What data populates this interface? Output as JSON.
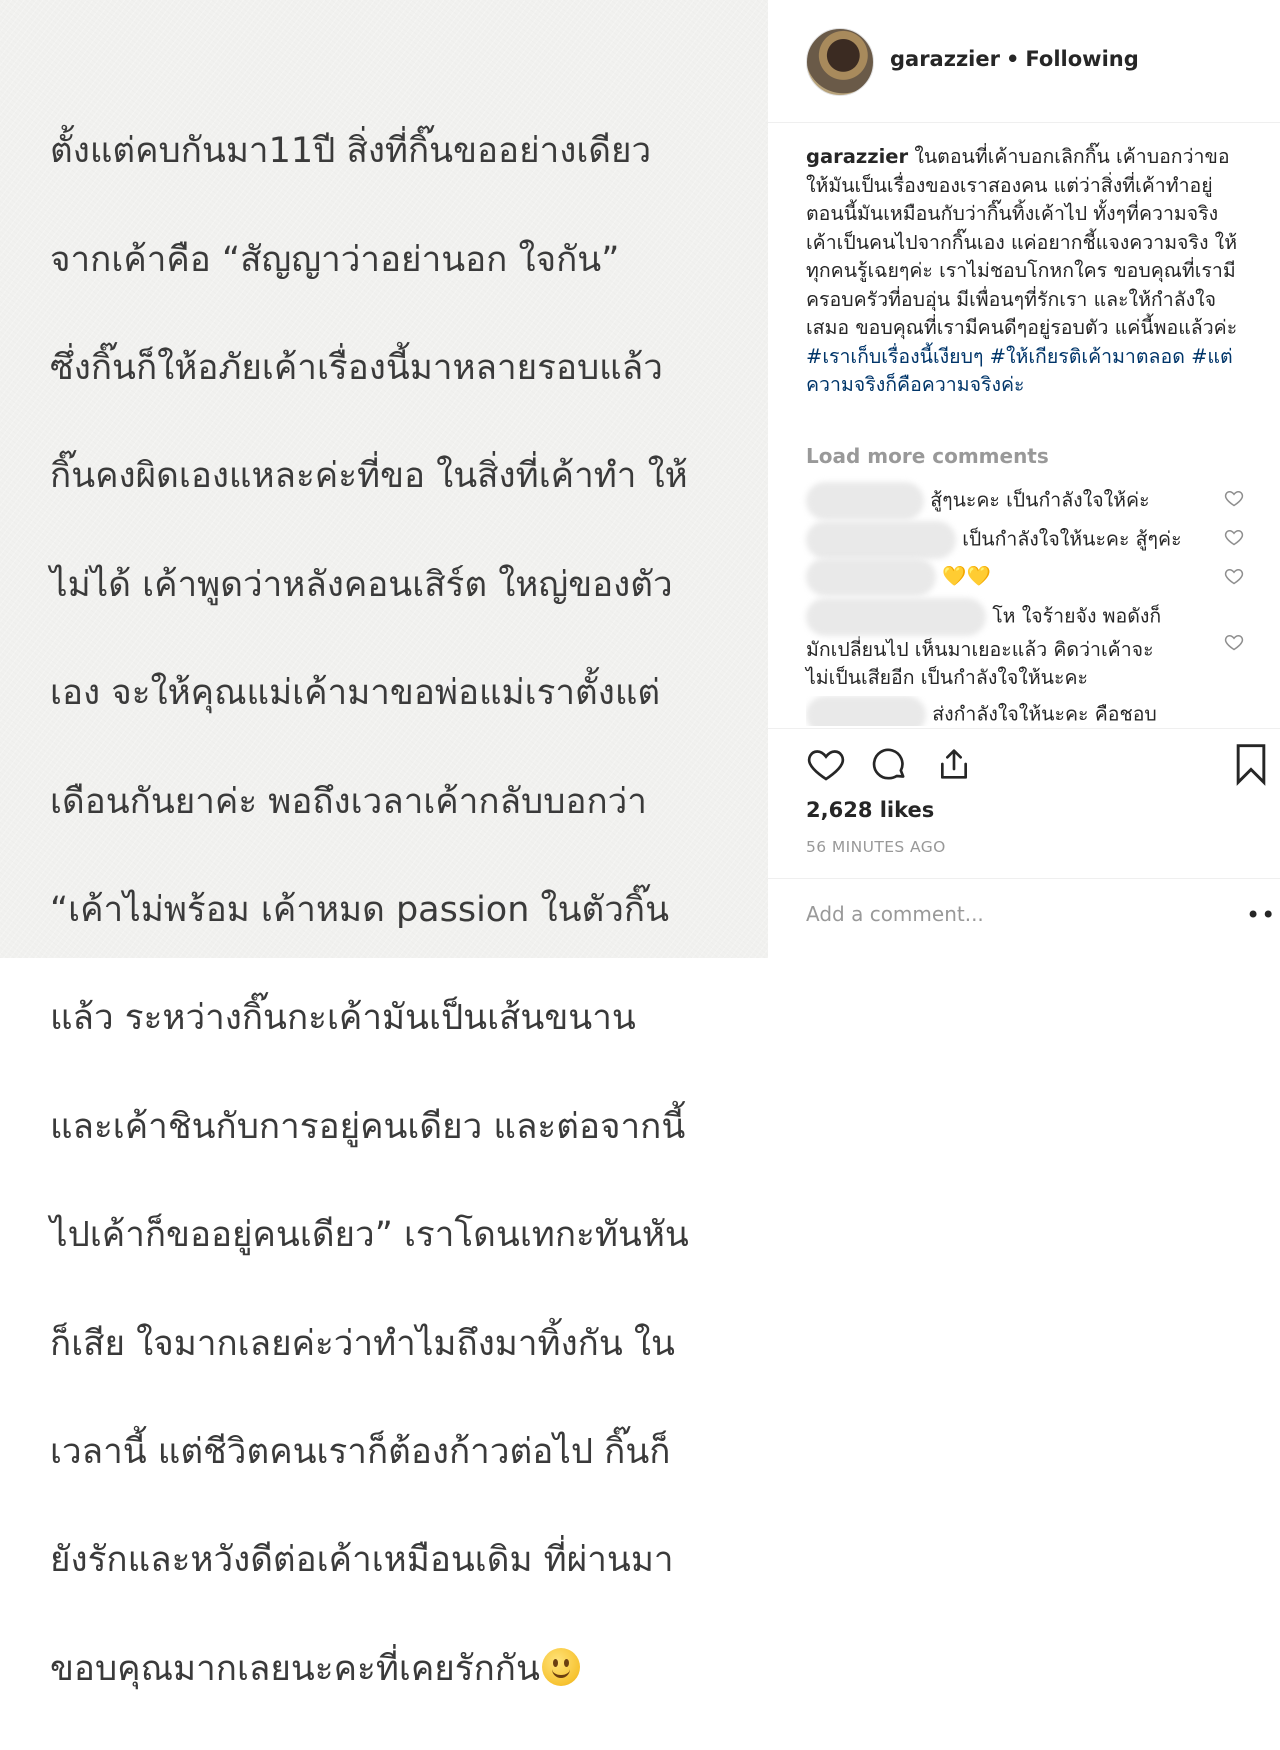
{
  "photo": {
    "lines": [
      "ตั้งแต่คบกันมา11ปี สิ่งที่กิ๊นขออย่างเดียว",
      "จากเค้าคือ “สัญญาว่าอย่านอก ใจกัน”",
      "ซึ่งกิ๊นก็ให้อภัยเค้าเรื่องนี้มาหลายรอบแล้ว",
      "กิ๊นคงผิดเองแหละค่ะที่ขอ ในสิ่งที่เค้าทำ ให้",
      "ไม่ได้ เค้าพูดว่าหลังคอนเสิร์ต ใหญ่ของตัว",
      "เอง จะให้คุณแม่เค้ามาขอพ่อแม่เราตั้งแต่",
      "เดือนกันยาค่ะ พอถึงเวลาเค้ากลับบอกว่า",
      "“เค้าไม่พร้อม เค้าหมด passion ในตัวกิ๊น",
      "แล้ว ระหว่างกิ๊นกะเค้ามันเป็นเส้นขนาน",
      "และเค้าชินกับการอยู่คนเดียว และต่อจากนี้",
      "ไปเค้าก็ขออยู่คนเดียว” เราโดนเทกะทันหัน",
      "ก็เสีย ใจมากเลยค่ะว่าทำไมถึงมาทิ้งกัน ใน",
      "เวลานี้ แต่ชีวิตคนเราก็ต้องก้าวต่อไป กิ๊นก็",
      "ยังรักและหวังดีต่อเค้าเหมือนเดิม ที่ผ่านมา",
      "ขอบคุณมากเลยนะคะที่เคยรักกัน"
    ]
  },
  "header": {
    "username": "garazzier",
    "separator": "•",
    "follow_status": "Following"
  },
  "caption": {
    "username": "garazzier",
    "text": "ในตอนที่เค้าบอกเลิกกิ๊น เค้าบอกว่าขอให้มันเป็นเรื่องของเราสองคน แต่ว่าสิ่งที่เค้าทำอยู่ตอนนี้มันเหมือนกับว่ากิ๊นทิ้งเค้าไป ทั้งๆที่ความจริงเค้าเป็นคนไปจากกิ๊นเอง แค่อยากชี้แจงความจริง ให้ทุกคนรู้เฉยๆค่ะ เราไม่ชอบโกหกใคร ขอบคุณที่เรามีครอบครัวที่อบอุ่น มีเพื่อนๆที่รักเรา และให้กำลังใจเสมอ ขอบคุณที่เรามีคนดีๆอยู่รอบตัว แค่นี้พอแล้วค่ะ",
    "tags": [
      "#เราเก็บเรื่องนี้เงียบๆ",
      "#ให้เกียรติเค้ามาตลอด",
      "#แต่ความจริงก็คือความจริงค่ะ"
    ]
  },
  "load_more": "Load more comments",
  "comments": [
    {
      "text": "สู้ๆนะคะ เป็นกำลังใจให้ค่ะ"
    },
    {
      "text": "เป็นกำลังใจให้นะคะ สู้ๆค่ะ"
    },
    {
      "text": "💛💛"
    },
    {
      "text_line1": "โห ใจร้ายจัง พอดังก็",
      "text_line2": "มักเปลี่ยนไป เห็นมาเยอะแล้ว คิดว่าเค้าจะ",
      "text_line3": "ไม่เป็นเสียอีก เป็นกำลังใจให้นะคะ"
    },
    {
      "text": "ส่งกำลังใจให้นะคะ คือชอบ"
    }
  ],
  "likes": "2,628 likes",
  "time_ago": "56 MINUTES AGO",
  "add_comment_placeholder": "Add a comment...",
  "more_label": "•••",
  "icons": [
    "heart-icon",
    "comment-icon",
    "share-icon",
    "bookmark-icon",
    "more-icon"
  ]
}
